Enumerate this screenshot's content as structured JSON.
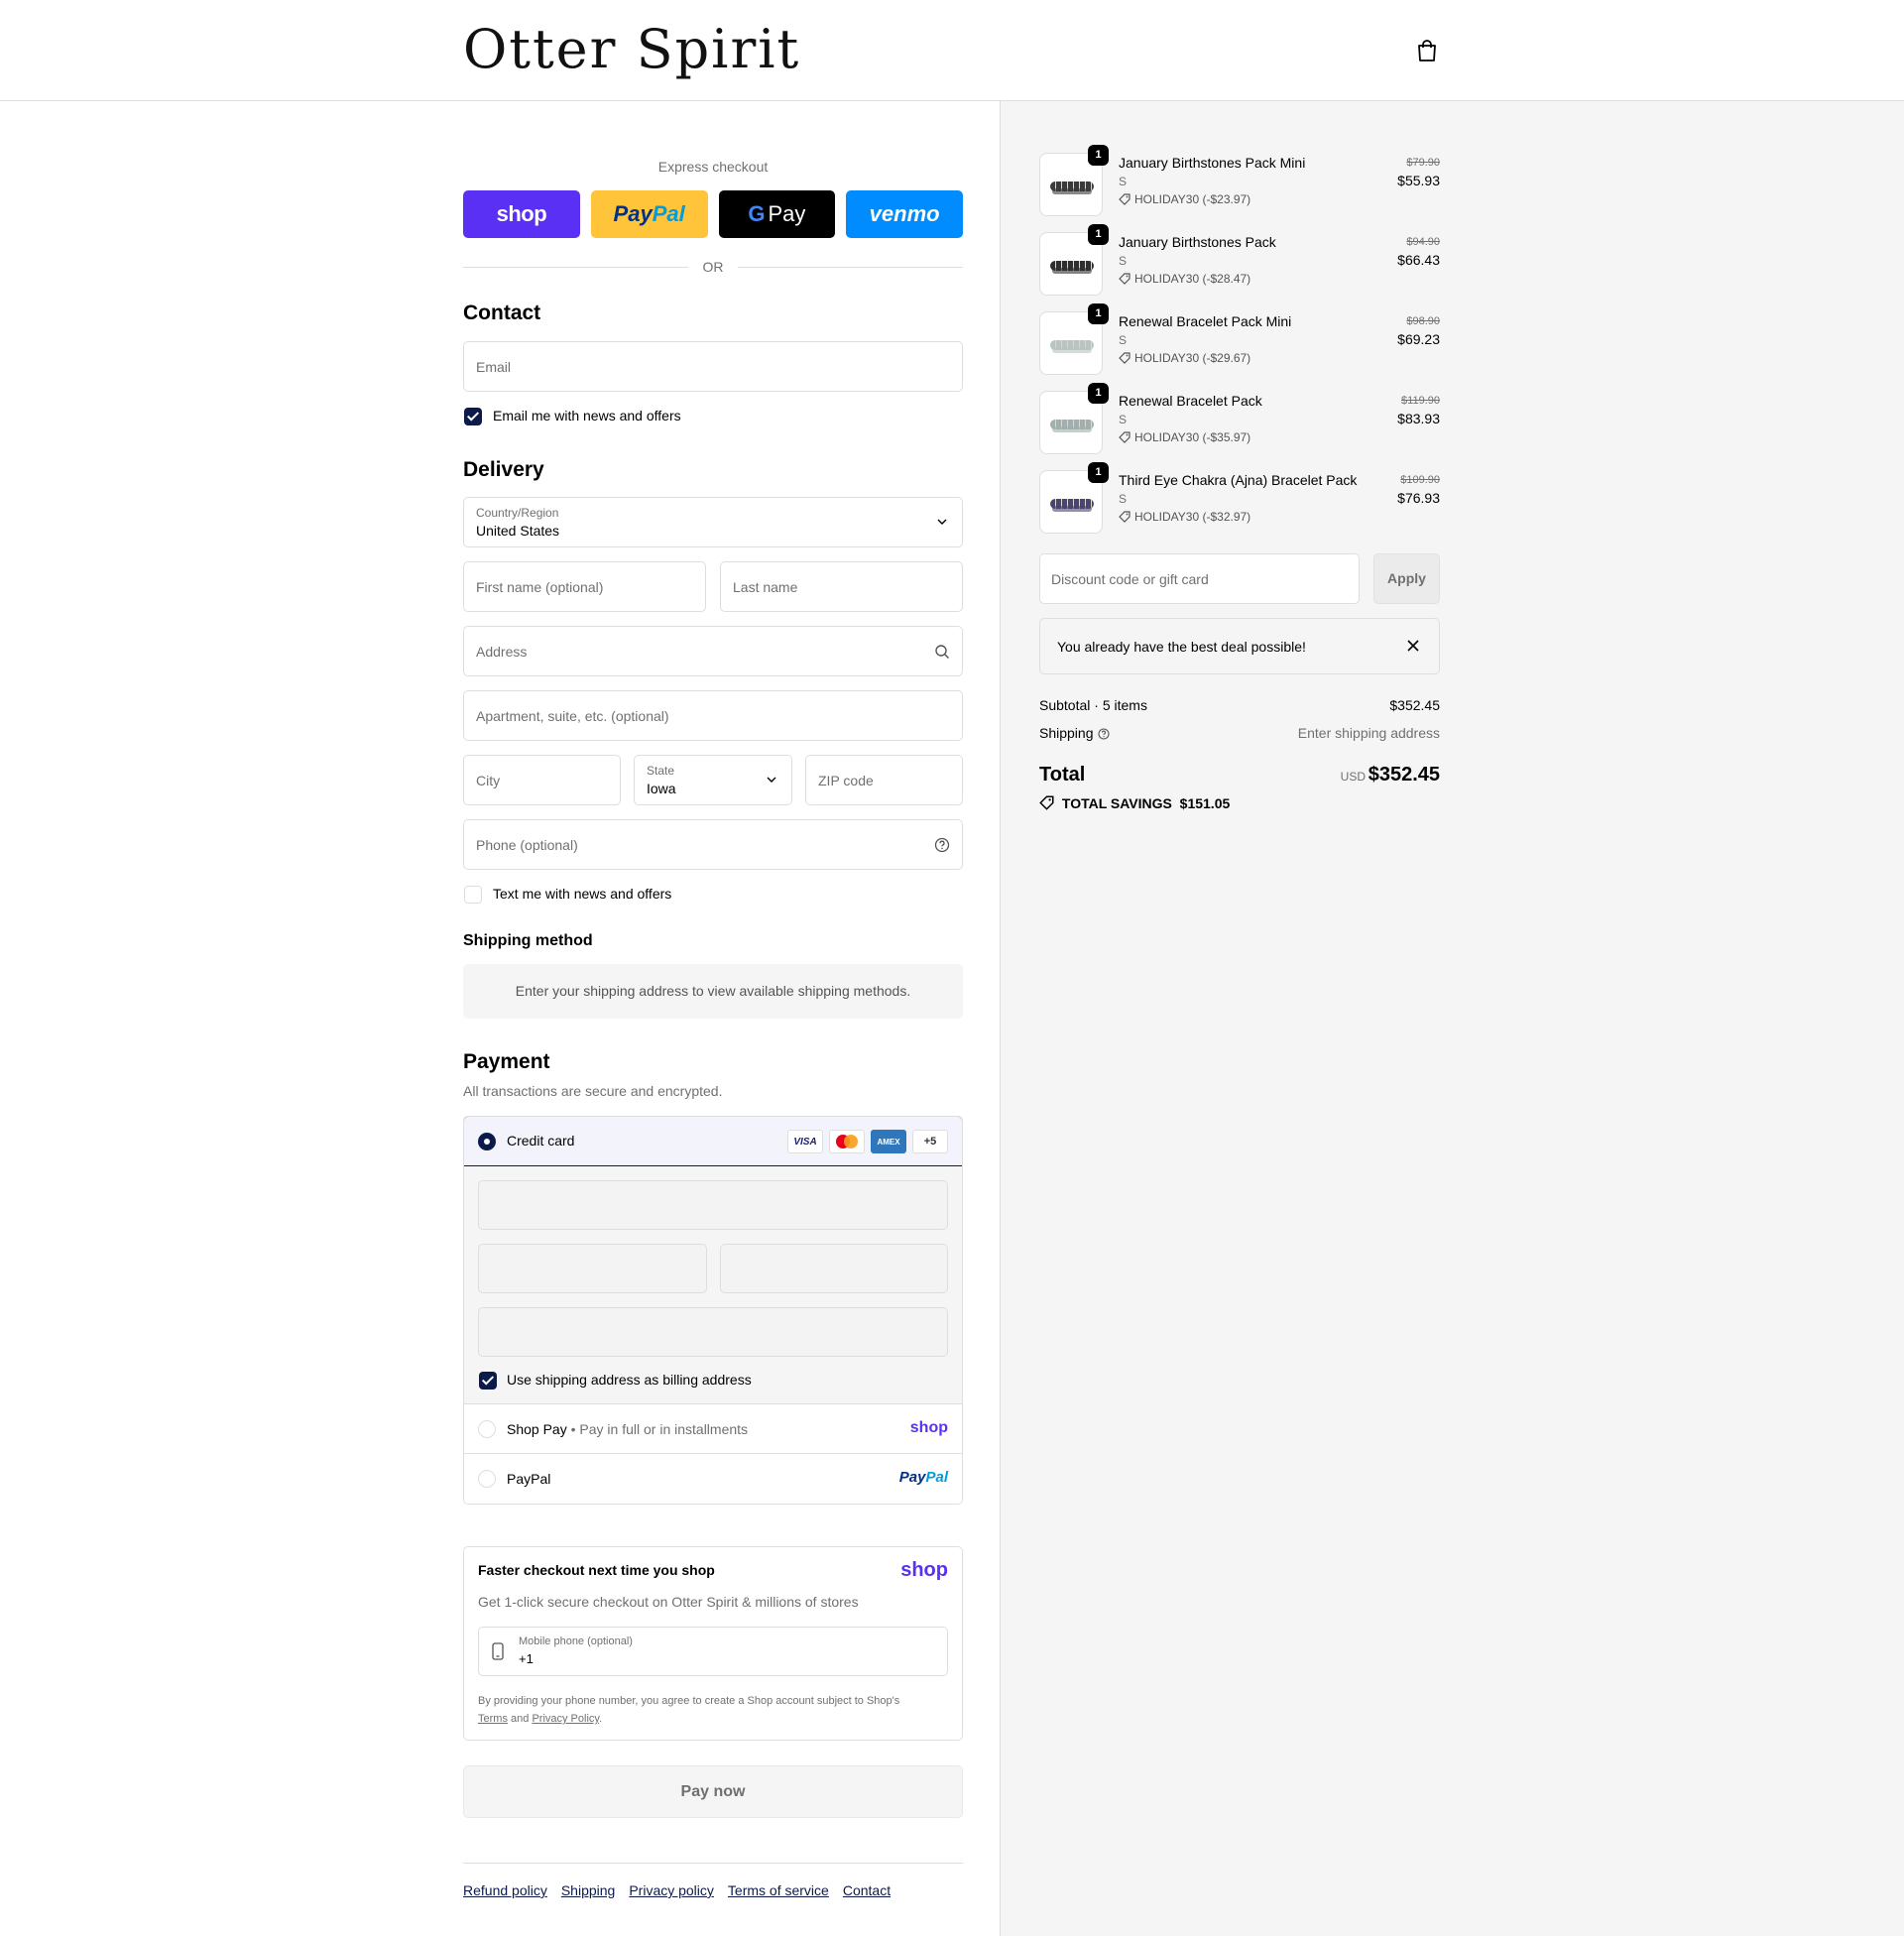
{
  "header": {
    "logo": "Otter Spirit"
  },
  "express": {
    "title": "Express checkout",
    "shop": "shop",
    "paypal_a": "Pay",
    "paypal_b": "Pal",
    "gpay_g": "G",
    "gpay_text": "Pay",
    "venmo": "venmo",
    "or": "OR"
  },
  "contact": {
    "heading": "Contact",
    "email_placeholder": "Email",
    "news_label": "Email me with news and offers"
  },
  "delivery": {
    "heading": "Delivery",
    "country_label": "Country/Region",
    "country_value": "United States",
    "first_name": "First name (optional)",
    "last_name": "Last name",
    "address": "Address",
    "apartment": "Apartment, suite, etc. (optional)",
    "city": "City",
    "state_label": "State",
    "state_value": "Iowa",
    "zip": "ZIP code",
    "phone": "Phone (optional)",
    "text_label": "Text me with news and offers"
  },
  "shipping_method": {
    "heading": "Shipping method",
    "message": "Enter your shipping address to view available shipping methods."
  },
  "payment": {
    "heading": "Payment",
    "sub": "All transactions are secure and encrypted.",
    "credit_card": "Credit card",
    "visa": "VISA",
    "amex": "AMEX",
    "more": "+5",
    "billing_label": "Use shipping address as billing address",
    "shop_pay": "Shop Pay",
    "shop_pay_sub": "Pay in full or in installments",
    "shop_brand": "shop",
    "paypal": "PayPal",
    "paypal_brand_a": "Pay",
    "paypal_brand_b": "Pal"
  },
  "faster": {
    "title": "Faster checkout next time you shop",
    "brand": "shop",
    "sub": "Get 1-click secure checkout on Otter Spirit & millions of stores",
    "mobile_label": "Mobile phone (optional)",
    "mobile_value": "+1",
    "fine_a": "By providing your phone number, you agree to create a Shop account subject to Shop's",
    "terms": "Terms",
    "and": "and",
    "privacy": "Privacy Policy",
    "period": "."
  },
  "pay_now": "Pay now",
  "footer": [
    "Refund policy",
    "Shipping",
    "Privacy policy",
    "Terms of service",
    "Contact"
  ],
  "items": [
    {
      "qty": "1",
      "name": "January Birthstones Pack Mini",
      "variant": "S",
      "discount": "HOLIDAY30 (-$23.97)",
      "old": "$79.90",
      "price": "$55.93",
      "color": "#3a3a3a"
    },
    {
      "qty": "1",
      "name": "January Birthstones Pack",
      "variant": "S",
      "discount": "HOLIDAY30 (-$28.47)",
      "old": "$94.90",
      "price": "$66.43",
      "color": "#2e2e2e"
    },
    {
      "qty": "1",
      "name": "Renewal Bracelet Pack Mini",
      "variant": "S",
      "discount": "HOLIDAY30 (-$29.67)",
      "old": "$98.90",
      "price": "$69.23",
      "color": "#b8c4c2"
    },
    {
      "qty": "1",
      "name": "Renewal Bracelet Pack",
      "variant": "S",
      "discount": "HOLIDAY30 (-$35.97)",
      "old": "$119.90",
      "price": "$83.93",
      "color": "#9fb0ad"
    },
    {
      "qty": "1",
      "name": "Third Eye Chakra (Ajna) Bracelet Pack",
      "variant": "S",
      "discount": "HOLIDAY30 (-$32.97)",
      "old": "$109.90",
      "price": "$76.93",
      "color": "#4a4570"
    }
  ],
  "summary": {
    "discount_placeholder": "Discount code or gift card",
    "apply": "Apply",
    "notice": "You already have the best deal possible!",
    "subtotal_label": "Subtotal · 5 items",
    "subtotal": "$352.45",
    "shipping_label": "Shipping",
    "shipping_value": "Enter shipping address",
    "total_label": "Total",
    "currency": "USD",
    "total": "$352.45",
    "savings_label": "TOTAL SAVINGS",
    "savings": "$151.05"
  },
  "colors": {
    "accent": "#0c1a4a",
    "shop_purple": "#5a31f4",
    "paypal_yellow": "#ffc439",
    "venmo_blue": "#008cff"
  }
}
